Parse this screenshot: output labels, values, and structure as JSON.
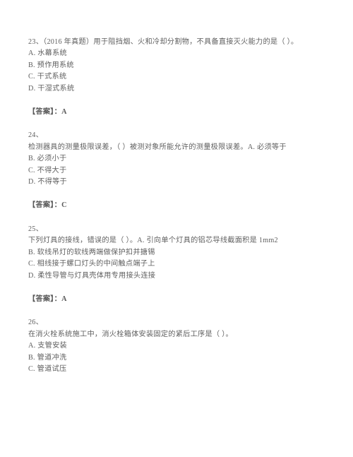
{
  "document": {
    "type": "exam-question-sheet",
    "language": "zh-CN",
    "background_color": "#ffffff",
    "text_color": "#5f5f5f"
  },
  "answer_label": "【答案】：",
  "questions": [
    {
      "number": "23、",
      "stem": "（2016 年真题）用于阻挡烟、火和冷却分割物，不具备直接灭火能力的是（    ）。",
      "stem_inline_with_number": true,
      "options": [
        "A. 水幕系统",
        "B. 预作用系统",
        "C. 干式系统",
        "D. 干湿式系统"
      ],
      "answer": "A",
      "answer_text": "【答案】：A"
    },
    {
      "number": "24、",
      "stem": "检测器具的测量极限误差，（    ）被测对象所能允许的测量极限误差。A. 必须等于",
      "stem_inline_with_number": false,
      "options": [
        "B. 必须小于",
        "C. 不得大于",
        "D. 不得等于"
      ],
      "answer": "C",
      "answer_text": "【答案】：C"
    },
    {
      "number": "25、",
      "stem": "下列灯具的接线，错误的是（    ）。A. 引向单个灯具的铝芯导线截面积是 1mm2",
      "stem_inline_with_number": false,
      "options": [
        "B. 软线吊灯的软线两端做保护扣并搪锡",
        "C. 相线接于螺口灯头的中间触点端子上",
        "D. 柔性导管与灯具壳体用专用接头连接"
      ],
      "answer": "A",
      "answer_text": "【答案】：A"
    },
    {
      "number": "26、",
      "stem": "在消火栓系统施工中，消火栓箱体安装固定的紧后工序是（    ）。",
      "stem_inline_with_number": false,
      "options": [
        "A. 支管安装",
        "B. 管道冲洗",
        "C. 管道试压"
      ],
      "answer": "",
      "answer_text": ""
    }
  ]
}
